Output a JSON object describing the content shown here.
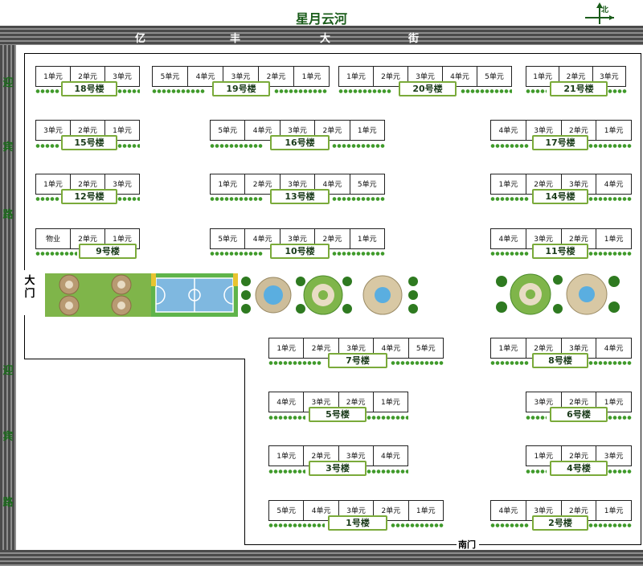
{
  "title": "星月云河",
  "compass": {
    "label": "北"
  },
  "roads": {
    "top_chars": [
      "亿",
      "丰",
      "大",
      "街"
    ],
    "left_upper_chars": [
      "迎",
      "宾",
      "路"
    ],
    "left_lower_chars": [
      "迎",
      "宾",
      "路"
    ]
  },
  "gates": {
    "main": [
      "大",
      "门"
    ],
    "south": "南门"
  },
  "buildings": [
    {
      "id": "b18",
      "label": "18号楼",
      "units": [
        "1单元",
        "2单元",
        "3单元"
      ]
    },
    {
      "id": "b19",
      "label": "19号楼",
      "units": [
        "5单元",
        "4单元",
        "3单元",
        "2单元",
        "1单元"
      ]
    },
    {
      "id": "b20",
      "label": "20号楼",
      "units": [
        "1单元",
        "2单元",
        "3单元",
        "4单元",
        "5单元"
      ]
    },
    {
      "id": "b21",
      "label": "21号楼",
      "units": [
        "1单元",
        "2单元",
        "3单元"
      ]
    },
    {
      "id": "b15",
      "label": "15号楼",
      "units": [
        "3单元",
        "2单元",
        "1单元"
      ]
    },
    {
      "id": "b16",
      "label": "16号楼",
      "units": [
        "5单元",
        "4单元",
        "3单元",
        "2单元",
        "1单元"
      ]
    },
    {
      "id": "b17",
      "label": "17号楼",
      "units": [
        "4单元",
        "3单元",
        "2单元",
        "1单元"
      ]
    },
    {
      "id": "b12",
      "label": "12号楼",
      "units": [
        "1单元",
        "2单元",
        "3单元"
      ]
    },
    {
      "id": "b13",
      "label": "13号楼",
      "units": [
        "1单元",
        "2单元",
        "3单元",
        "4单元",
        "5单元"
      ]
    },
    {
      "id": "b14",
      "label": "14号楼",
      "units": [
        "1单元",
        "2单元",
        "3单元",
        "4单元"
      ]
    },
    {
      "id": "b9",
      "label": "9号楼",
      "units": [
        "物业",
        "2单元",
        "1单元"
      ]
    },
    {
      "id": "b10",
      "label": "10号楼",
      "units": [
        "5单元",
        "4单元",
        "3单元",
        "2单元",
        "1单元"
      ]
    },
    {
      "id": "b11",
      "label": "11号楼",
      "units": [
        "4单元",
        "3单元",
        "2单元",
        "1单元"
      ]
    },
    {
      "id": "b7",
      "label": "7号楼",
      "units": [
        "1单元",
        "2单元",
        "3单元",
        "4单元",
        "5单元"
      ]
    },
    {
      "id": "b8",
      "label": "8号楼",
      "units": [
        "1单元",
        "2单元",
        "3单元",
        "4单元"
      ]
    },
    {
      "id": "b5",
      "label": "5号楼",
      "units": [
        "4单元",
        "3单元",
        "2单元",
        "1单元"
      ]
    },
    {
      "id": "b6",
      "label": "6号楼",
      "units": [
        "3单元",
        "2单元",
        "1单元"
      ]
    },
    {
      "id": "b3",
      "label": "3号楼",
      "units": [
        "1单元",
        "2单元",
        "3单元",
        "4单元"
      ]
    },
    {
      "id": "b4",
      "label": "4号楼",
      "units": [
        "1单元",
        "2单元",
        "3单元"
      ]
    },
    {
      "id": "b1",
      "label": "1号楼",
      "units": [
        "5单元",
        "4单元",
        "3单元",
        "2单元",
        "1单元"
      ]
    },
    {
      "id": "b2",
      "label": "2号楼",
      "units": [
        "4单元",
        "3单元",
        "2单元",
        "1单元"
      ]
    }
  ]
}
